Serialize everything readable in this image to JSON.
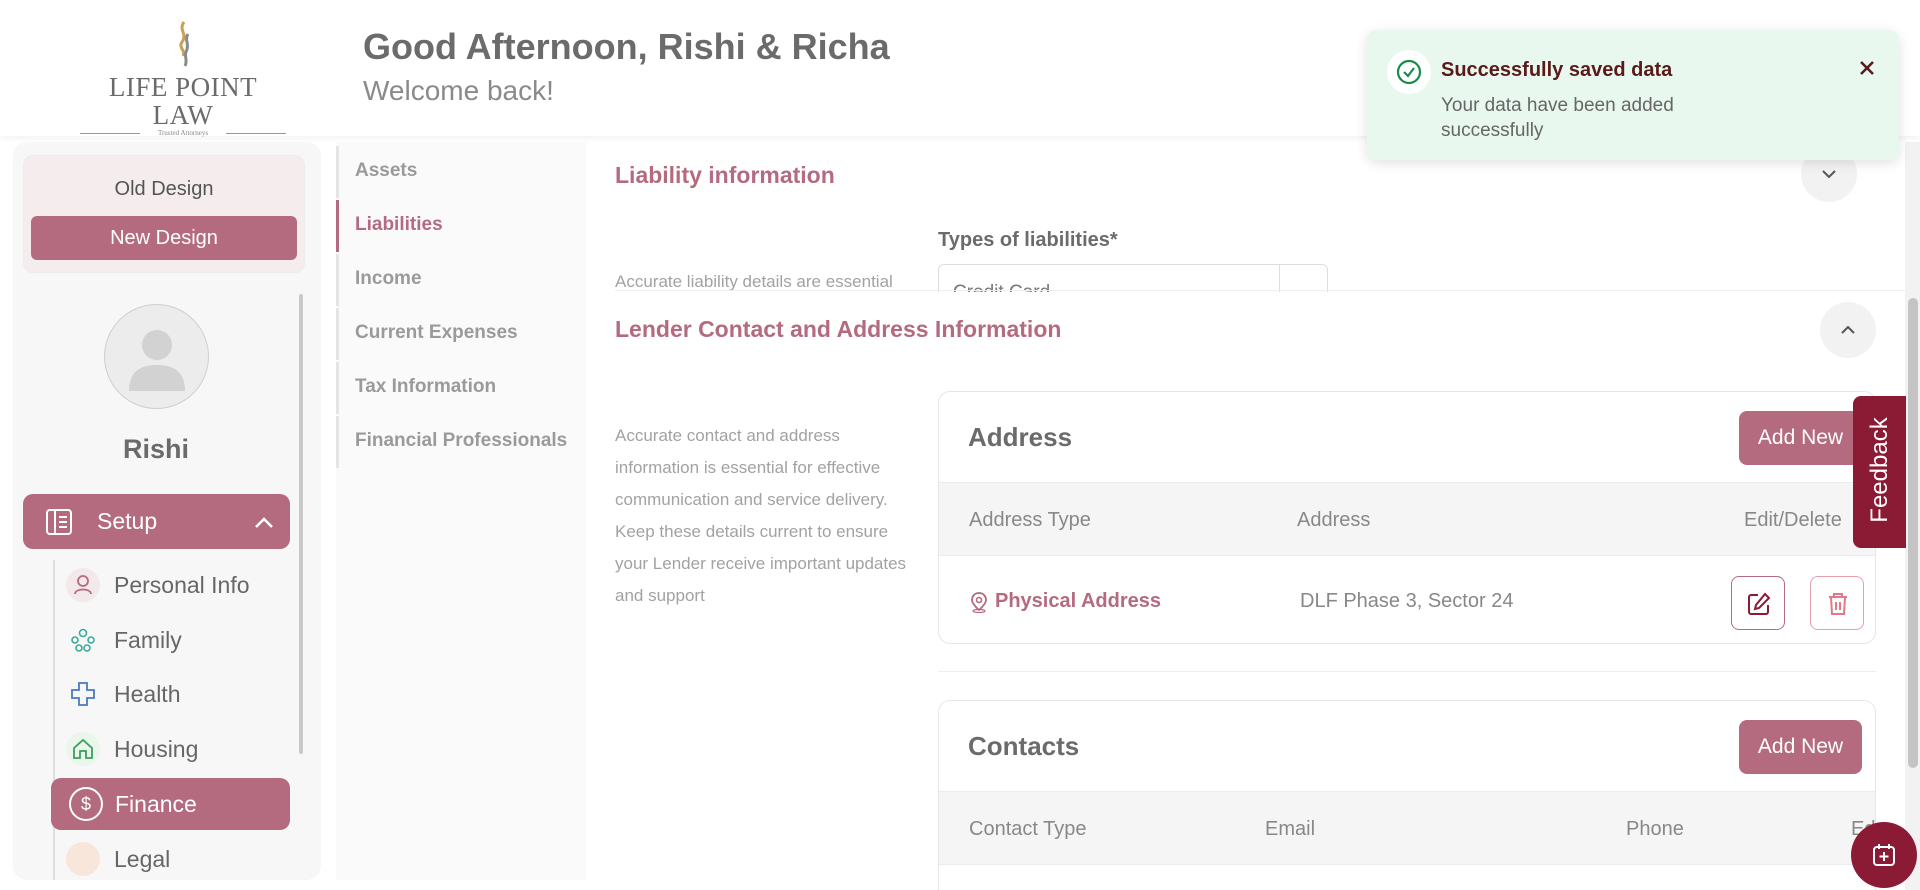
{
  "brand": {
    "name": "LIFE POINT LAW",
    "tagline": "Trusted Attorneys"
  },
  "header": {
    "greeting": "Good Afternoon, Rishi & Richa",
    "subtitle": "Welcome back!"
  },
  "design_toggle": {
    "old_label": "Old Design",
    "new_label": "New Design",
    "selected": "New Design"
  },
  "user": {
    "name": "Rishi"
  },
  "setup": {
    "label": "Setup",
    "expanded": true
  },
  "menu": [
    {
      "label": "Personal Info",
      "icon": "person-icon",
      "active": false
    },
    {
      "label": "Family",
      "icon": "family-icon",
      "active": false
    },
    {
      "label": "Health",
      "icon": "health-cross-icon",
      "active": false
    },
    {
      "label": "Housing",
      "icon": "house-icon",
      "active": false
    },
    {
      "label": "Finance",
      "icon": "dollar-icon",
      "active": true
    },
    {
      "label": "Legal",
      "icon": "legal-icon",
      "active": false
    }
  ],
  "subnav": [
    {
      "label": "Assets",
      "active": false
    },
    {
      "label": "Liabilities",
      "active": true
    },
    {
      "label": "Income",
      "active": false
    },
    {
      "label": "Current Expenses",
      "active": false
    },
    {
      "label": "Tax Information",
      "active": false
    },
    {
      "label": "Financial Professionals",
      "active": false
    }
  ],
  "liability_section": {
    "title": "Liability information",
    "description": "Accurate liability details are essential",
    "types_label": "Types of liabilities*",
    "types_value": "Credit Card"
  },
  "lender_section": {
    "title": "Lender Contact and Address Information",
    "description": "Accurate contact and address information is essential for effective communication and service delivery. Keep these details current to ensure your Lender receive important updates and support"
  },
  "address_card": {
    "title": "Address",
    "add_label": "Add New",
    "columns": [
      "Address Type",
      "Address",
      "Edit/Delete"
    ],
    "rows": [
      {
        "type": "Physical Address",
        "address": "DLF Phase 3, Sector 24"
      }
    ]
  },
  "contacts_card": {
    "title": "Contacts",
    "add_label": "Add New",
    "columns": [
      "Contact Type",
      "Email",
      "Phone",
      "Ed"
    ]
  },
  "toast": {
    "title": "Successfully saved data",
    "message": "Your data have been added successfully"
  },
  "feedback": {
    "label": "Feedback"
  },
  "colors": {
    "accent": "#b46b7f",
    "dark_accent": "#8b1a35",
    "toast_bg": "#e8f8ee",
    "success": "#1a8a4a"
  }
}
